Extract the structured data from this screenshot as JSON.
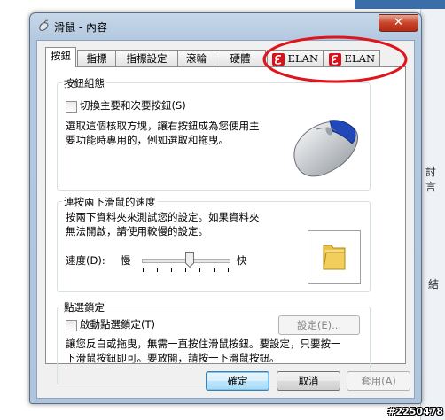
{
  "window": {
    "title": "滑鼠 - 內容",
    "close_label": "✕"
  },
  "tabs": [
    {
      "label": "按鈕",
      "active": true
    },
    {
      "label": "指標",
      "active": false
    },
    {
      "label": "指標設定",
      "active": false
    },
    {
      "label": "滾輪",
      "active": false
    },
    {
      "label": "硬體",
      "active": false
    },
    {
      "label": "ELAN",
      "active": false
    },
    {
      "label": "ELAN",
      "active": false
    }
  ],
  "button_config": {
    "group_title": "按鈕組態",
    "switch_checkbox_label": "切換主要和次要按鈕(S)",
    "switch_checked": false,
    "description_line1": "選取這個核取方塊，讓右按鈕成為您使用主",
    "description_line2": "要功能時專用的，例如選取和拖曳。"
  },
  "double_click": {
    "group_title": "連按兩下滑鼠的速度",
    "description_line1": "按兩下資料夾來測試您的設定。如果資料夾",
    "description_line2": "無法開啟，請使用較慢的設定。",
    "speed_label": "速度(D):",
    "slow_label": "慢",
    "fast_label": "快",
    "speed_value": 0.55
  },
  "click_lock": {
    "group_title": "點選鎖定",
    "checkbox_label": "啟動點選鎖定(T)",
    "checked": false,
    "settings_button": "設定(E)...",
    "description_line1": "讓您反白或拖曳，無需一直按住滑鼠按鈕。要設定，只要按一",
    "description_line2": "下滑鼠按鈕即可。要放開，請按一下滑鼠按鈕。"
  },
  "footer": {
    "ok": "確定",
    "cancel": "取消",
    "apply": "套用(A)"
  },
  "background": {
    "side_text_1": "討言",
    "side_text_2": "結"
  },
  "watermark": "#2250478",
  "colors": {
    "annotation_red": "#e0141b",
    "elan_red": "#d8121b",
    "window_frame": "#b3c9e0"
  }
}
